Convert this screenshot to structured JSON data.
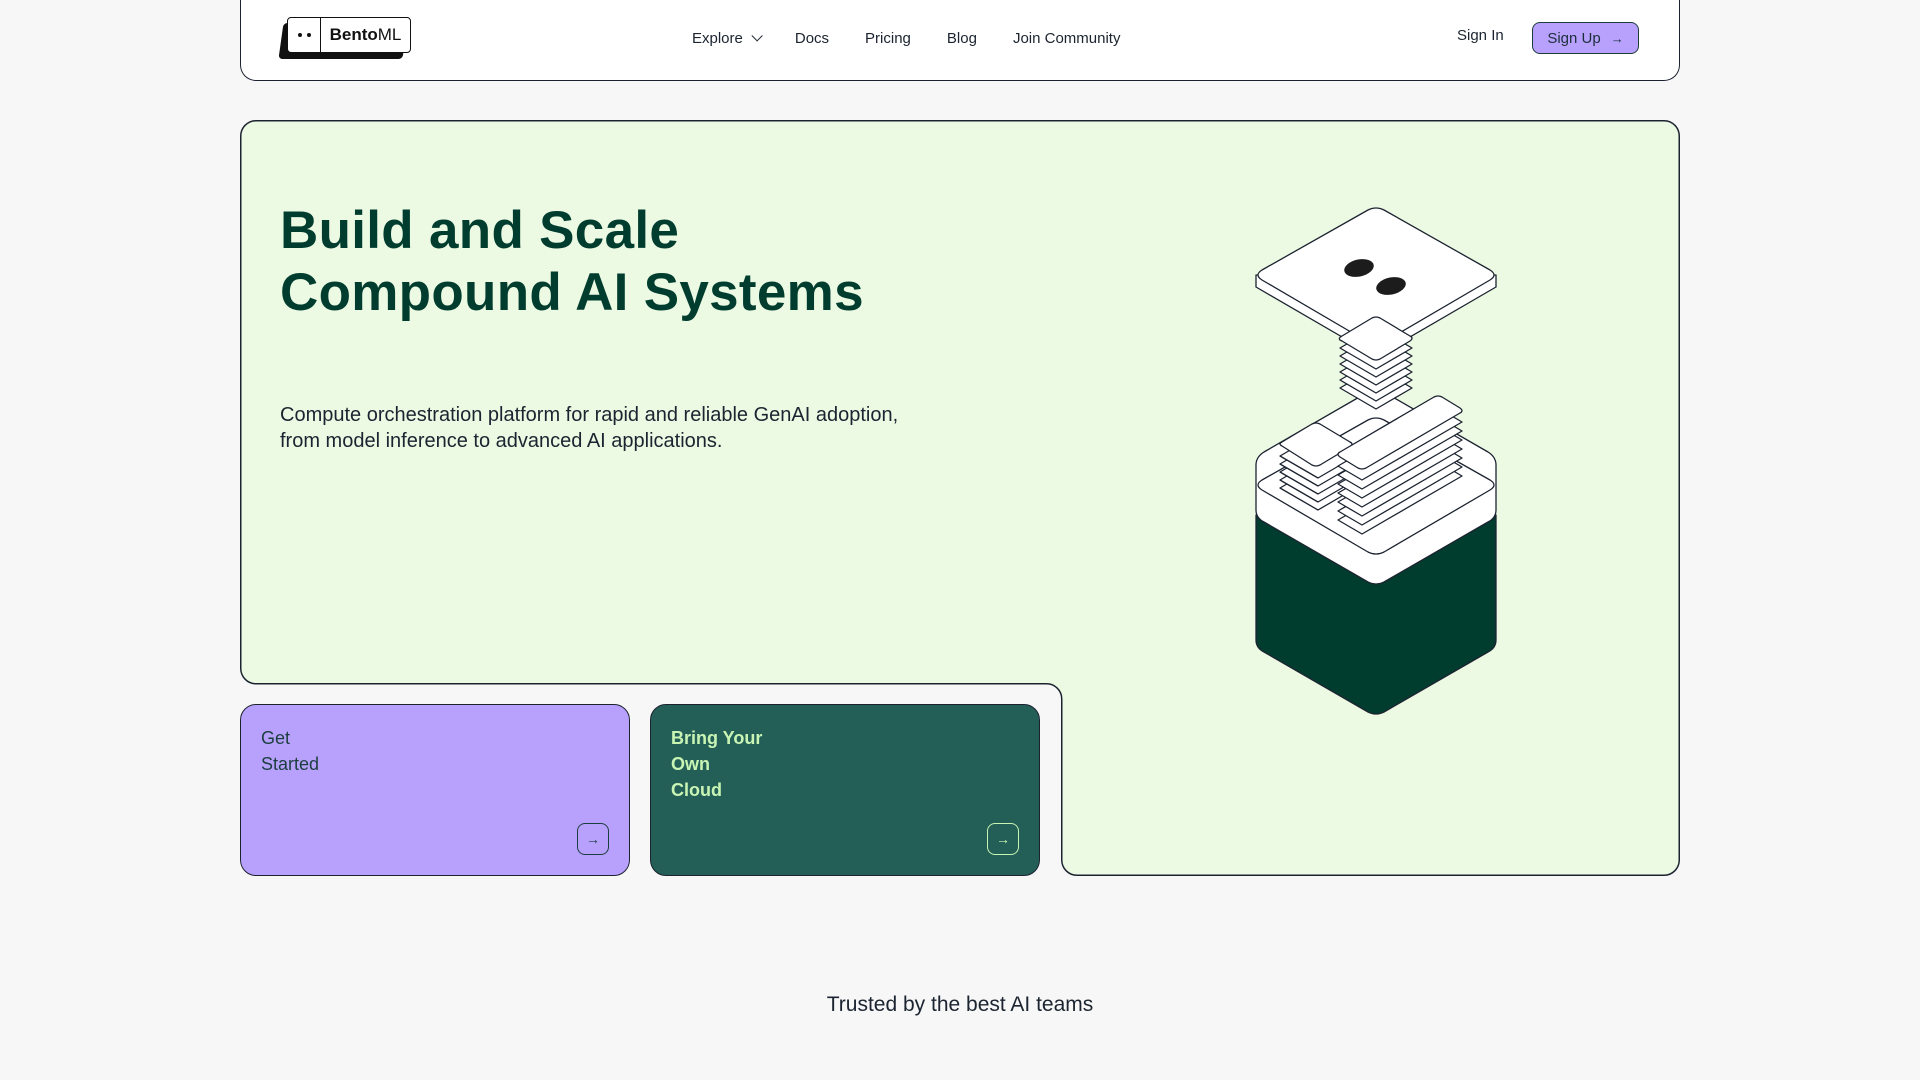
{
  "nav": {
    "logo": {
      "bold": "Bento",
      "regular": "ML"
    },
    "links": [
      {
        "label": "Explore",
        "has_dropdown": true
      },
      {
        "label": "Docs"
      },
      {
        "label": "Pricing"
      },
      {
        "label": "Blog"
      },
      {
        "label": "Join Community"
      }
    ],
    "sign_in": "Sign In",
    "sign_up": "Sign Up",
    "sign_up_icon": "arrow-right-icon"
  },
  "hero": {
    "title_line1": "Build and Scale",
    "title_line2": "Compound AI Systems",
    "description": "Compute orchestration platform for rapid and reliable GenAI adoption, from model inference to advanced AI applications.",
    "illustration": "bento-box-stack-illustration",
    "cards": [
      {
        "lines": [
          "Get",
          "Started"
        ],
        "icon": "arrow-right-icon",
        "color": "#b8a0fd"
      },
      {
        "lines": [
          "Bring Your",
          "Own",
          "Cloud"
        ],
        "icon": "arrow-right-icon",
        "color": "#235e57"
      }
    ]
  },
  "colors": {
    "hero_bg": "#ecf9e3",
    "brand_dark_green": "#003d2e",
    "purple": "#b8a0fd",
    "teal": "#235e57",
    "light_green_text": "#c9f5b4"
  },
  "trusted": {
    "label": "Trusted by the best AI teams"
  }
}
